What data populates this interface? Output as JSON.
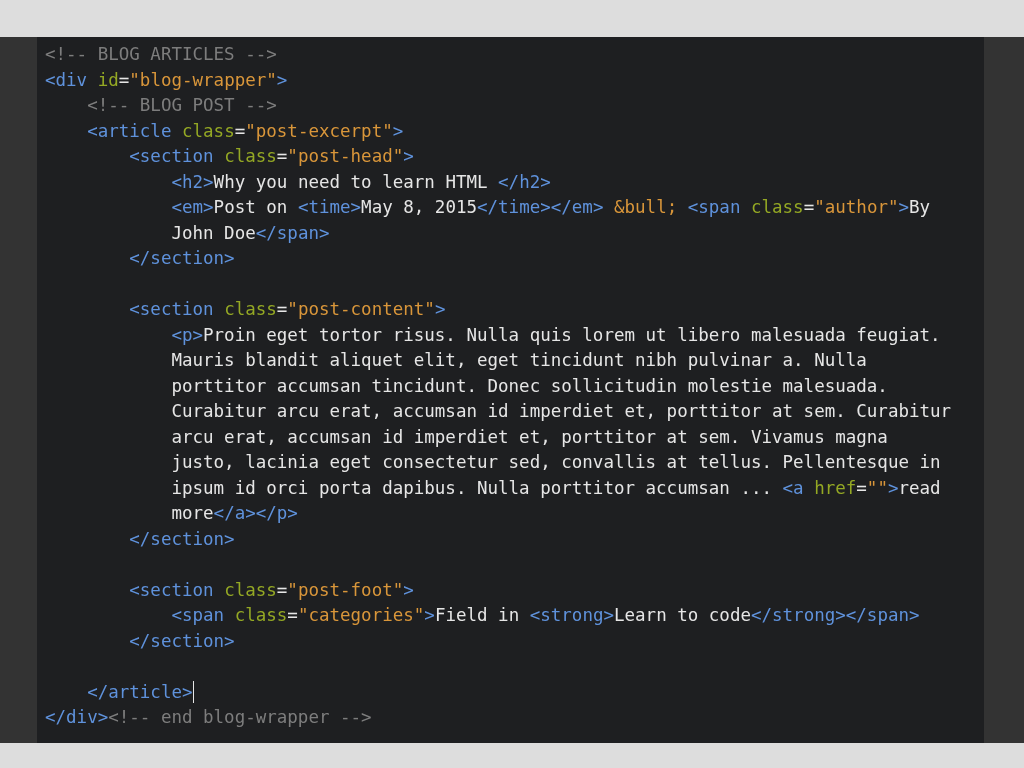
{
  "editor": {
    "lines": [
      {
        "kind": "code",
        "tokens": [
          {
            "kind": "comment",
            "text": "<!-- BLOG ARTICLES -->"
          }
        ]
      },
      {
        "kind": "code",
        "tokens": [
          {
            "kind": "tag",
            "text": "<div "
          },
          {
            "kind": "attr",
            "text": "id"
          },
          {
            "kind": "text",
            "text": "="
          },
          {
            "kind": "string",
            "text": "\"blog-wrapper\""
          },
          {
            "kind": "tag",
            "text": ">"
          }
        ]
      },
      {
        "kind": "code",
        "tokens": [
          {
            "kind": "comment",
            "text": "    <!-- BLOG POST -->"
          }
        ]
      },
      {
        "kind": "code",
        "tokens": [
          {
            "kind": "tag",
            "text": "    <article "
          },
          {
            "kind": "attr",
            "text": "class"
          },
          {
            "kind": "text",
            "text": "="
          },
          {
            "kind": "string",
            "text": "\"post-excerpt\""
          },
          {
            "kind": "tag",
            "text": ">"
          }
        ]
      },
      {
        "kind": "code",
        "tokens": [
          {
            "kind": "tag",
            "text": "        <section "
          },
          {
            "kind": "attr",
            "text": "class"
          },
          {
            "kind": "text",
            "text": "="
          },
          {
            "kind": "string",
            "text": "\"post-head\""
          },
          {
            "kind": "tag",
            "text": ">"
          }
        ]
      },
      {
        "kind": "code",
        "tokens": [
          {
            "kind": "tag",
            "text": "            <h2>"
          },
          {
            "kind": "text",
            "text": "Why you need to learn HTML "
          },
          {
            "kind": "tag",
            "text": "</h2>"
          }
        ]
      },
      {
        "kind": "code",
        "tokens": [
          {
            "kind": "tag",
            "text": "            <em>"
          },
          {
            "kind": "text",
            "text": "Post on "
          },
          {
            "kind": "tag",
            "text": "<time>"
          },
          {
            "kind": "text",
            "text": "May 8, 2015"
          },
          {
            "kind": "tag",
            "text": "</time></em> "
          },
          {
            "kind": "entity",
            "text": "&bull; "
          },
          {
            "kind": "tag",
            "text": "<span "
          },
          {
            "kind": "attr",
            "text": "class"
          },
          {
            "kind": "text",
            "text": "="
          },
          {
            "kind": "string",
            "text": "\"author\""
          },
          {
            "kind": "tag",
            "text": ">"
          },
          {
            "kind": "text",
            "text": "By"
          }
        ]
      },
      {
        "kind": "code",
        "tokens": [
          {
            "kind": "text",
            "text": "            John Doe"
          },
          {
            "kind": "tag",
            "text": "</span>"
          }
        ]
      },
      {
        "kind": "code",
        "tokens": [
          {
            "kind": "tag",
            "text": "        </section>"
          }
        ]
      },
      {
        "kind": "blank"
      },
      {
        "kind": "code",
        "tokens": [
          {
            "kind": "tag",
            "text": "        <section "
          },
          {
            "kind": "attr",
            "text": "class"
          },
          {
            "kind": "text",
            "text": "="
          },
          {
            "kind": "string",
            "text": "\"post-content\""
          },
          {
            "kind": "tag",
            "text": ">"
          }
        ]
      },
      {
        "kind": "code",
        "tokens": [
          {
            "kind": "tag",
            "text": "            <p>"
          },
          {
            "kind": "text",
            "text": "Proin eget tortor risus. Nulla quis lorem ut libero malesuada feugiat."
          }
        ]
      },
      {
        "kind": "code",
        "tokens": [
          {
            "kind": "text",
            "text": "            Mauris blandit aliquet elit, eget tincidunt nibh pulvinar a. Nulla"
          }
        ]
      },
      {
        "kind": "code",
        "tokens": [
          {
            "kind": "text",
            "text": "            porttitor accumsan tincidunt. Donec sollicitudin molestie malesuada."
          }
        ]
      },
      {
        "kind": "code",
        "tokens": [
          {
            "kind": "text",
            "text": "            Curabitur arcu erat, accumsan id imperdiet et, porttitor at sem. Curabitur"
          }
        ]
      },
      {
        "kind": "code",
        "tokens": [
          {
            "kind": "text",
            "text": "            arcu erat, accumsan id imperdiet et, porttitor at sem. Vivamus magna"
          }
        ]
      },
      {
        "kind": "code",
        "tokens": [
          {
            "kind": "text",
            "text": "            justo, lacinia eget consectetur sed, convallis at tellus. Pellentesque in"
          }
        ]
      },
      {
        "kind": "code",
        "tokens": [
          {
            "kind": "text",
            "text": "            ipsum id orci porta dapibus. Nulla porttitor accumsan ... "
          },
          {
            "kind": "tag",
            "text": "<a "
          },
          {
            "kind": "attr",
            "text": "href"
          },
          {
            "kind": "text",
            "text": "="
          },
          {
            "kind": "string",
            "text": "\"\""
          },
          {
            "kind": "tag",
            "text": ">"
          },
          {
            "kind": "text",
            "text": "read"
          }
        ]
      },
      {
        "kind": "code",
        "tokens": [
          {
            "kind": "text",
            "text": "            more"
          },
          {
            "kind": "tag",
            "text": "</a></p>"
          }
        ]
      },
      {
        "kind": "code",
        "tokens": [
          {
            "kind": "tag",
            "text": "        </section>"
          }
        ]
      },
      {
        "kind": "blank"
      },
      {
        "kind": "code",
        "tokens": [
          {
            "kind": "tag",
            "text": "        <section "
          },
          {
            "kind": "attr",
            "text": "class"
          },
          {
            "kind": "text",
            "text": "="
          },
          {
            "kind": "string",
            "text": "\"post-foot\""
          },
          {
            "kind": "tag",
            "text": ">"
          }
        ]
      },
      {
        "kind": "code",
        "tokens": [
          {
            "kind": "tag",
            "text": "            <span "
          },
          {
            "kind": "attr",
            "text": "class"
          },
          {
            "kind": "text",
            "text": "="
          },
          {
            "kind": "string",
            "text": "\"categories\""
          },
          {
            "kind": "tag",
            "text": ">"
          },
          {
            "kind": "text",
            "text": "Field in "
          },
          {
            "kind": "tag",
            "text": "<strong>"
          },
          {
            "kind": "text",
            "text": "Learn to code"
          },
          {
            "kind": "tag",
            "text": "</strong></span>"
          }
        ]
      },
      {
        "kind": "code",
        "tokens": [
          {
            "kind": "tag",
            "text": "        </section>"
          }
        ]
      },
      {
        "kind": "blank"
      },
      {
        "kind": "code",
        "cursor": true,
        "tokens": [
          {
            "kind": "tag",
            "text": "    </article>"
          }
        ]
      },
      {
        "kind": "code",
        "tokens": [
          {
            "kind": "tag",
            "text": "</div>"
          },
          {
            "kind": "comment",
            "text": "<!-- end blog-wrapper -->"
          }
        ]
      }
    ]
  }
}
